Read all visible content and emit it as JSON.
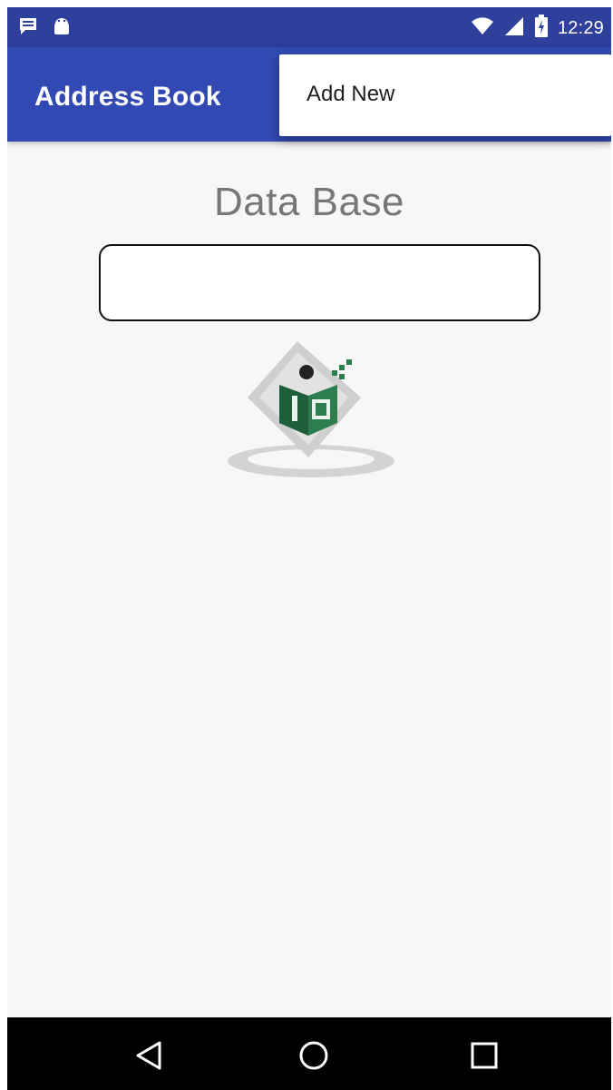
{
  "status_bar": {
    "time": "12:29",
    "icons": [
      "message-icon",
      "android-icon",
      "wifi-icon",
      "signal-icon",
      "battery-charging-icon"
    ]
  },
  "app_bar": {
    "title": "Address Book"
  },
  "overflow_menu": {
    "items": [
      {
        "label": "Add New"
      }
    ]
  },
  "main": {
    "title": "Data Base",
    "input_value": "",
    "logo_icon": "tutorialspoint-logo"
  },
  "nav_bar": {
    "buttons": [
      "back-icon",
      "home-icon",
      "recents-icon"
    ]
  },
  "colors": {
    "status_bar": "#2e3f9c",
    "app_bar": "#3249b3",
    "background": "#f7f7f7",
    "logo_green": "#2e7d4f"
  }
}
